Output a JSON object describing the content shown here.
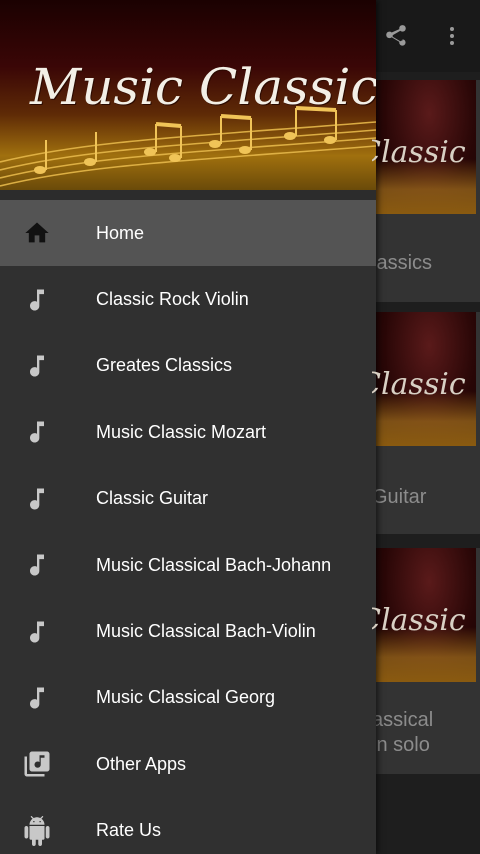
{
  "background_screen": {
    "cards": [
      {
        "thumb_text": "Classic",
        "title": "lassics"
      },
      {
        "thumb_text": "Classic",
        "title": "Guitar"
      },
      {
        "thumb_text": "Classic",
        "title_line1": "assical",
        "title_line2": "in solo"
      }
    ]
  },
  "drawer": {
    "header_title": "Music Classic",
    "menu": [
      {
        "label": "Home",
        "icon": "home-icon",
        "active": true
      },
      {
        "label": "Classic Rock Violin",
        "icon": "music-note-icon"
      },
      {
        "label": "Greates Classics",
        "icon": "music-note-icon"
      },
      {
        "label": "Music Classic Mozart",
        "icon": "music-note-icon"
      },
      {
        "label": "Classic Guitar",
        "icon": "music-note-icon"
      },
      {
        "label": "Music Classical Bach-Johann",
        "icon": "music-note-icon"
      },
      {
        "label": "Music Classical Bach-Violin",
        "icon": "music-note-icon"
      },
      {
        "label": "Music Classical Georg",
        "icon": "music-note-icon"
      },
      {
        "label": "Other Apps",
        "icon": "library-music-icon"
      },
      {
        "label": "Rate Us",
        "icon": "android-icon"
      }
    ]
  },
  "colors": {
    "drawer_bg": "#303030",
    "active_item_bg": "#545454",
    "icon_color": "#c8c8c8",
    "text_color": "#ffffff",
    "header_gold": "#a0700e",
    "header_dark_red": "#3a0606"
  }
}
